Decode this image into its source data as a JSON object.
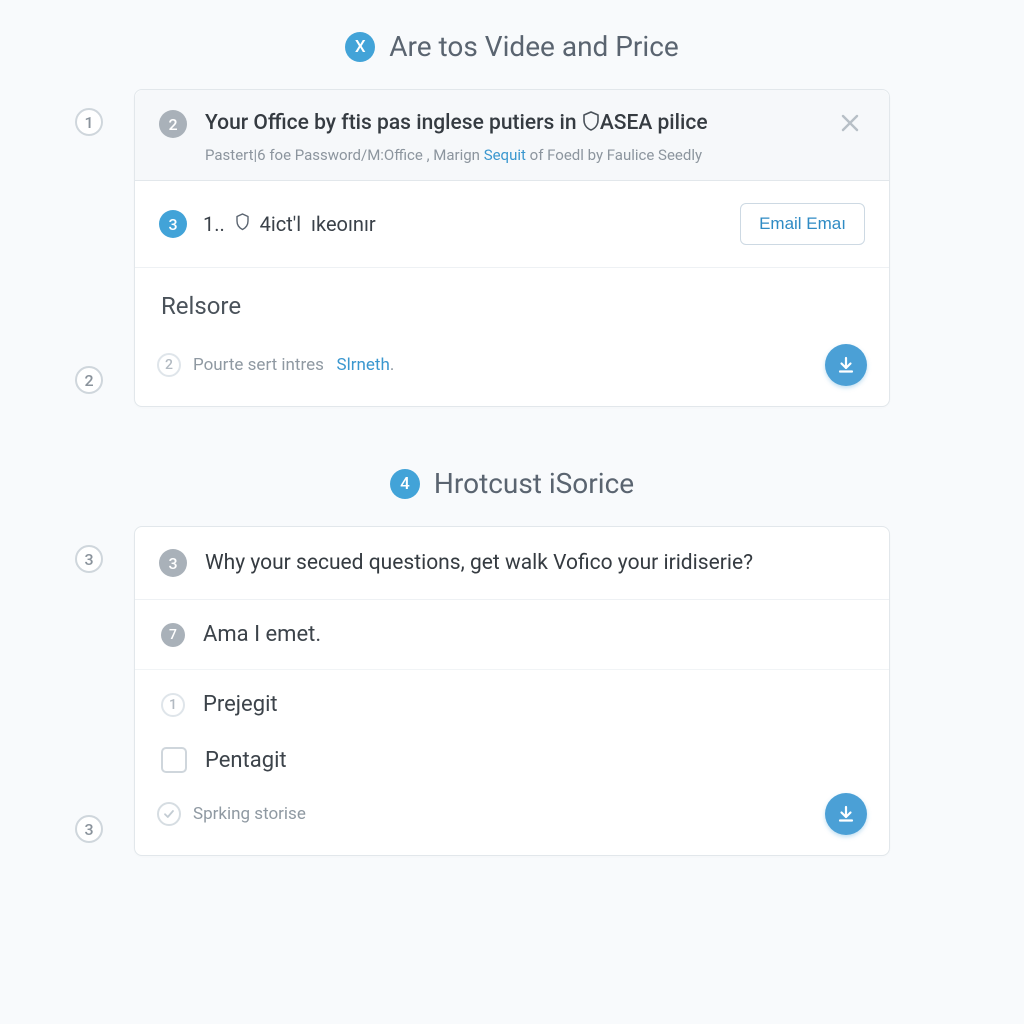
{
  "section1": {
    "title_badge": "X",
    "title": "Are tos Videe and Price"
  },
  "card1": {
    "gutter_badge": "1",
    "header_badge": "2",
    "header_title_before": "Your Office by ftis pas inglese putiers in",
    "header_title_after": "ASEA pilice",
    "header_sub_a": "Pastert|6 foe Password/M:Office ,  Marign",
    "header_sub_link": "Sequit",
    "header_sub_b": "of Foedl by Faulice Seedly",
    "row1_badge": "3",
    "row1_text": "1..  ⃝  4ict'l  ıkeoınır",
    "row1_button": "Email Emaı",
    "body_label": "Relsore",
    "footer_gutter": "2",
    "footer_badge": "2",
    "footer_text_a": "Pourte sert intres",
    "footer_link": "Slrneth",
    "footer_text_b": "."
  },
  "section2": {
    "title_badge": "4",
    "title": "Hrotcust iSorice"
  },
  "card2": {
    "gutter_badge": "3",
    "header_badge": "3",
    "header_text": "Why your secued questions, get walk Vofico your iridiserie?",
    "opt1_badge": "7",
    "opt1_text": "Ama I emet.",
    "opt2_badge": "1",
    "opt2_text": "Prejegit",
    "opt3_text": "Pentagit",
    "footer_gutter": "3",
    "footer_text": "Sprking storise"
  }
}
